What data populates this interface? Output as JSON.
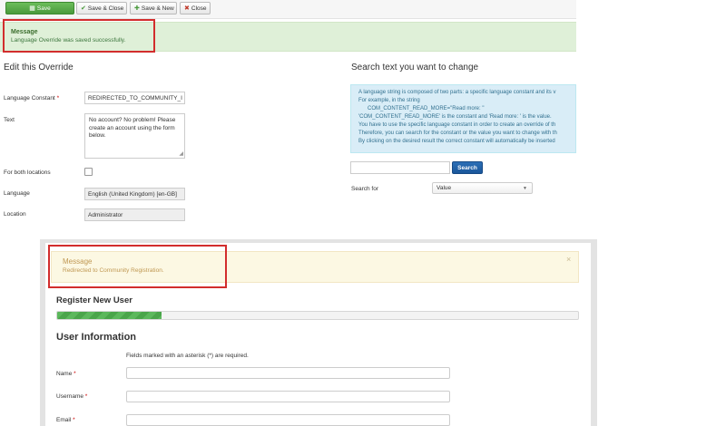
{
  "toolbar": {
    "save": "Save",
    "save_close": "Save & Close",
    "save_new": "Save & New",
    "close": "Close"
  },
  "admin_message": {
    "heading": "Message",
    "text": "Language Override was saved successfully."
  },
  "edit_override": {
    "title": "Edit this Override",
    "language_constant_label": "Language Constant",
    "language_constant_value": "REDIRECTED_TO_COMMUNITY_I",
    "text_label": "Text",
    "text_value": "No account? No problem! Please create an account using the form below.",
    "both_locations_label": "For both locations",
    "both_locations_checked": false,
    "language_label": "Language",
    "language_value": "English (United Kingdom) [en-GB]",
    "location_label": "Location",
    "location_value": "Administrator"
  },
  "search_panel": {
    "title": "Search text you want to change",
    "info_lines": [
      "A language string is composed of two parts: a specific language constant and its v",
      "For example, in the string",
      "COM_CONTENT_READ_MORE=\"Read more: \"",
      "'COM_CONTENT_READ_MORE' is the constant and 'Read more: ' is the value.",
      "You have to use the specific language constant in order to create an override of th",
      "Therefore, you can search for the constant or the value you want to change with th",
      "By clicking on the desired result the correct constant will automatically be inserted"
    ],
    "search_value": "",
    "search_button": "Search",
    "search_for_label": "Search for",
    "search_for_value": "Value"
  },
  "frontend_message": {
    "heading": "Message",
    "text": "Redirected to Community Registration.",
    "close_symbol": "×"
  },
  "register": {
    "title": "Register New User",
    "progress": 0.2,
    "section_title": "User Information",
    "required_note": "Fields marked with an asterisk (*) are required.",
    "fields": [
      {
        "label": "Name",
        "value": ""
      },
      {
        "label": "Username",
        "value": ""
      },
      {
        "label": "Email",
        "value": ""
      }
    ]
  },
  "colors": {
    "success_bg": "#dff0d8",
    "warning_bg": "#fcf8e3",
    "info_bg": "#d9edf7",
    "highlight": "#d22d2d",
    "save_button": "#5cb85c",
    "search_button": "#1f5fa6"
  }
}
